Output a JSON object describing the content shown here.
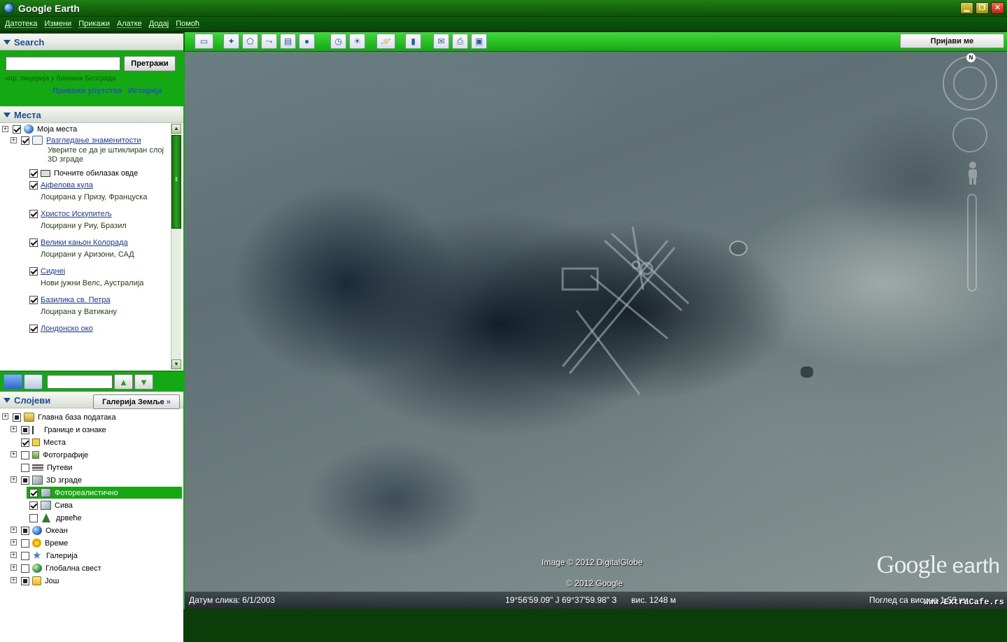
{
  "window": {
    "title": "Google Earth"
  },
  "menu": [
    "Датотека",
    "Измени",
    "Прикажи",
    "Алатке",
    "Додај",
    "Помоћ"
  ],
  "search": {
    "header": "Search",
    "input_value": "",
    "button_label": "Претражи",
    "hint": "нпр: пицерија у близини Београда",
    "link_directions": "Прикажи упутства",
    "link_history": "Историја"
  },
  "places": {
    "header": "Места",
    "items": [
      {
        "label": "Моја места",
        "sub": "",
        "link": false,
        "checked": "on"
      },
      {
        "label": "Разгледање знаменитости",
        "sub": "Уверите се да је штиклиран слој",
        "sub2": "3D зграде",
        "link": true,
        "checked": "on"
      },
      {
        "label": "Почните обилазак овде",
        "sub": "",
        "link": false,
        "checked": "on"
      },
      {
        "label": "Ајфелова кула",
        "sub": "Лоцирана у Призу, Француска",
        "link": true,
        "checked": "on"
      },
      {
        "label": "Христос Искупитељ",
        "sub": "Лоцирани у Риу, Бразил",
        "link": true,
        "checked": "on"
      },
      {
        "label": "Велики кањон Колорада",
        "sub": "Лоцирани у Аризони, САД",
        "link": true,
        "checked": "on"
      },
      {
        "label": "Сиднеј",
        "sub": "Нови јужни Велс, Аустралија",
        "link": true,
        "checked": "on"
      },
      {
        "label": "Базилика св. Петра",
        "sub": "Лоцирана у Ватикану",
        "link": true,
        "checked": "on"
      },
      {
        "label": "Лондонско око",
        "sub": "",
        "link": true,
        "checked": "on"
      }
    ],
    "toolbar_search_value": ""
  },
  "layers": {
    "header": "Слојеви",
    "gallery_button": "Галерија Земље",
    "items": [
      {
        "label": "Главна база података",
        "checked": "partial",
        "icon": "layers-icon"
      },
      {
        "label": "Границе и ознаке",
        "checked": "partial",
        "icon": "flag-icon"
      },
      {
        "label": "Места",
        "checked": "on",
        "icon": "places-icon"
      },
      {
        "label": "Фотографије",
        "checked": "off",
        "icon": "photo-icon"
      },
      {
        "label": "Путеви",
        "checked": "off",
        "icon": "roads-icon"
      },
      {
        "label": "3D зграде",
        "checked": "partial",
        "icon": "building-icon"
      },
      {
        "label": "Фотореалистично",
        "checked": "on",
        "icon": "building-icon",
        "selected": true
      },
      {
        "label": "Сива",
        "checked": "on",
        "icon": "building-icon"
      },
      {
        "label": "дрвеће",
        "checked": "off",
        "icon": "tree-icon"
      },
      {
        "label": "Океан",
        "checked": "partial",
        "icon": "ocean-icon"
      },
      {
        "label": "Време",
        "checked": "off",
        "icon": "weather-icon"
      },
      {
        "label": "Галерија",
        "checked": "off",
        "icon": "gallery-star-icon"
      },
      {
        "label": "Глобална свест",
        "checked": "off",
        "icon": "globe-icon"
      },
      {
        "label": "Још",
        "checked": "partial",
        "icon": "folder-icon"
      }
    ]
  },
  "toolbar": {
    "buttons": [
      "sidebar-toggle",
      "add-placemark",
      "add-polygon",
      "add-path",
      "add-image-overlay",
      "record-tour",
      "historical-imagery",
      "sunlight",
      "switch-planet",
      "ruler",
      "email",
      "print",
      "save-image"
    ],
    "signin_label": "Пријави ме"
  },
  "viewer": {
    "imagery_credit": "Image © 2012 DigitalGlobe",
    "google_credit": "© 2012 Google",
    "brand_google": "Google",
    "brand_earth": "earth",
    "compass_letter": "N"
  },
  "status": {
    "image_date": "Датум слика: 6/1/2003",
    "coordinates": "19°56'59.09\" Ј  69°37'59.98\" З",
    "elevation": "виc.  1248 м",
    "eye_alt": "Поглед са виcине  1,56 км"
  },
  "watermark": "www.ExtraCafe.rs"
}
